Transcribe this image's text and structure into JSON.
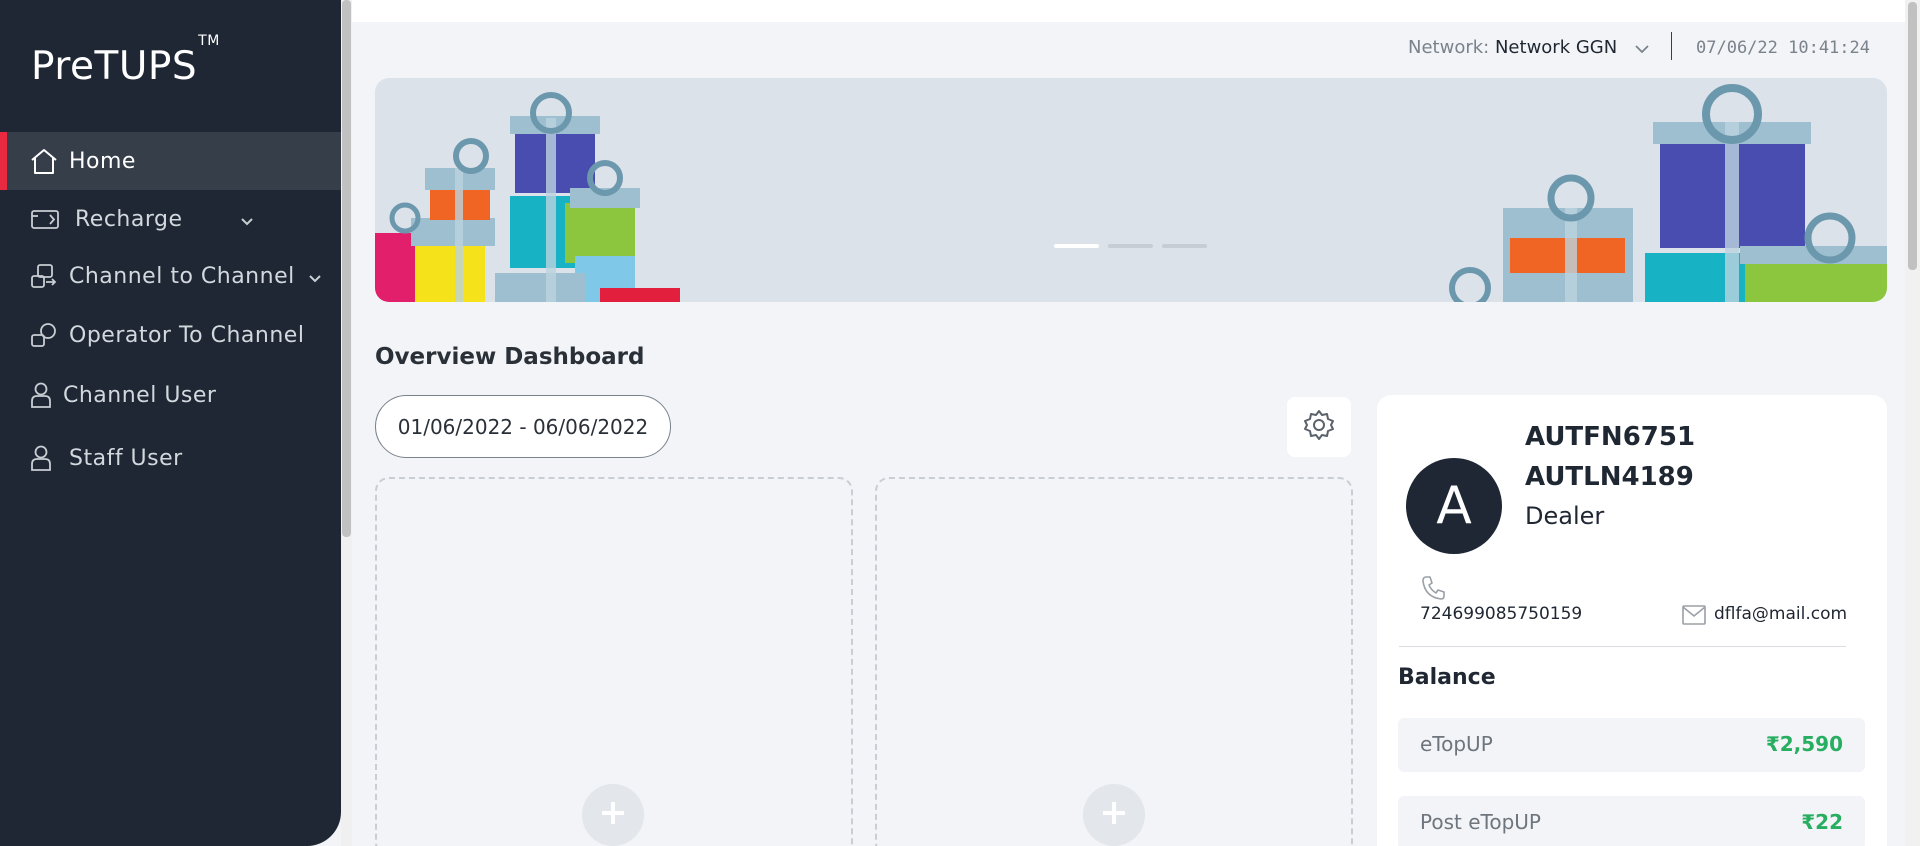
{
  "app": {
    "brand": "PreTUPS",
    "trademark": "TM"
  },
  "sidebar": {
    "items": [
      {
        "label": "Home",
        "icon": "home-icon",
        "active": true,
        "expandable": false
      },
      {
        "label": "Recharge",
        "icon": "recharge-icon",
        "active": false,
        "expandable": true
      },
      {
        "label": "Channel to Channel",
        "icon": "channel-transfer-icon",
        "active": false,
        "expandable": true
      },
      {
        "label": "Operator To Channel",
        "icon": "operator-transfer-icon",
        "active": false,
        "expandable": false
      },
      {
        "label": "Channel User",
        "icon": "user-icon",
        "active": false,
        "expandable": false
      },
      {
        "label": "Staff User",
        "icon": "user-icon",
        "active": false,
        "expandable": false
      }
    ]
  },
  "header": {
    "network_label": "Network:",
    "network_value": "Network GGN",
    "datetime": "07/06/22 10:41:24"
  },
  "banner": {
    "slides": 3,
    "active_slide": 0
  },
  "overview": {
    "title": "Overview Dashboard",
    "date_range": "01/06/2022 - 06/06/2022",
    "widgets": 2
  },
  "profile": {
    "avatar_letter": "A",
    "first_name": "AUTFN6751",
    "last_name": "AUTLN4189",
    "role": "Dealer",
    "phone": "724699085750159",
    "email": "dflfa@mail.com"
  },
  "balance": {
    "title": "Balance",
    "items": [
      {
        "label": "eTopUP",
        "amount": "₹2,590"
      },
      {
        "label": "Post eTopUP",
        "amount": "₹22"
      }
    ]
  },
  "colors": {
    "sidebar_bg": "#1e2733",
    "accent_red": "#e8293f",
    "balance_green": "#27ae60",
    "page_bg": "#f2f4f7"
  }
}
